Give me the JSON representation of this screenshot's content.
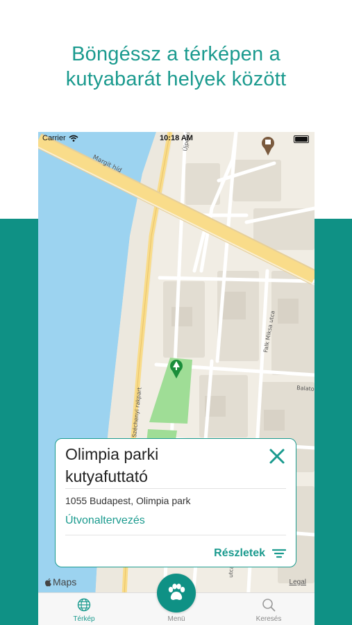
{
  "headline": {
    "line1": "Böngéssz a térképen a",
    "line2": "kutyabarát helyek között"
  },
  "status_bar": {
    "carrier": "Carrier",
    "time": "10:18 AM"
  },
  "map": {
    "street_labels": [
      "Margit híd",
      "Falk Miksa utca",
      "Balaton",
      "Széchenyi rakpart",
      "Újpesti",
      "utca"
    ],
    "attribution": "Maps",
    "legal": "Legal"
  },
  "place_card": {
    "title_line1": "Olimpia parki",
    "title_line2": "kutyafuttató",
    "address": "1055 Budapest, Olimpia park",
    "route_link": "Útvonaltervezés",
    "details_button": "Részletek"
  },
  "tab_bar": {
    "map_label": "Térkép",
    "menu_label": "Menü",
    "search_label": "Keresés"
  },
  "colors": {
    "accent": "#1a9a8e",
    "band": "#0f9185",
    "water": "#9cd3f0",
    "park": "#9fdd96",
    "road_major": "#f9dc8a"
  }
}
